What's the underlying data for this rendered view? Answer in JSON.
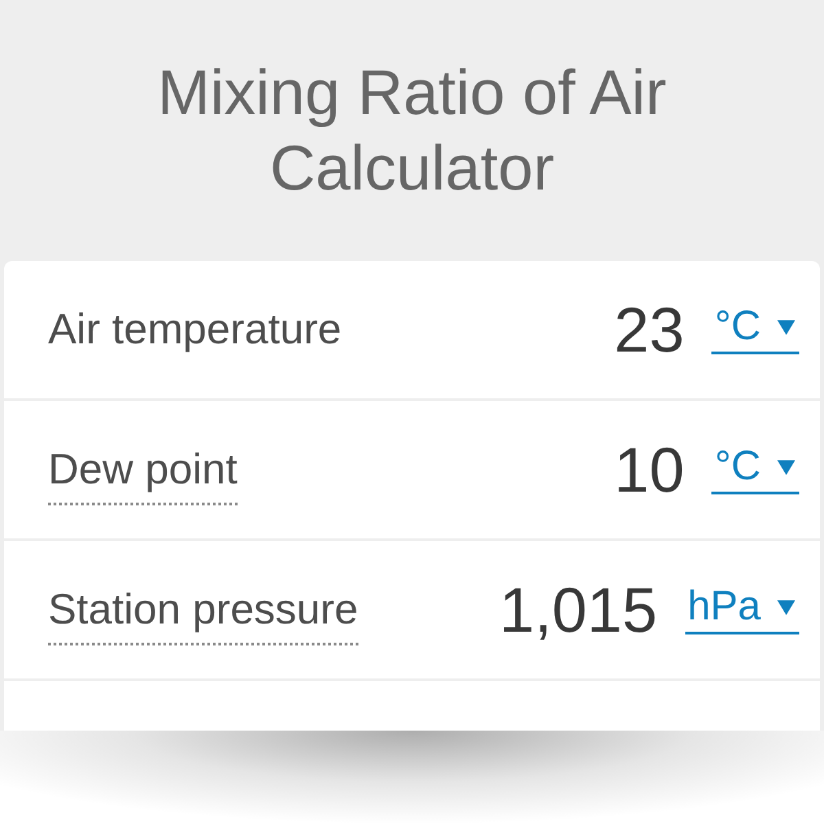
{
  "header": {
    "title": "Mixing Ratio of Air Calculator"
  },
  "fields": [
    {
      "label": "Air temperature",
      "has_tooltip": false,
      "value": "23",
      "unit": "°C"
    },
    {
      "label": "Dew point",
      "has_tooltip": true,
      "value": "10",
      "unit": "°C"
    },
    {
      "label": "Station pressure",
      "has_tooltip": true,
      "value": "1,015",
      "unit": "hPa"
    }
  ]
}
